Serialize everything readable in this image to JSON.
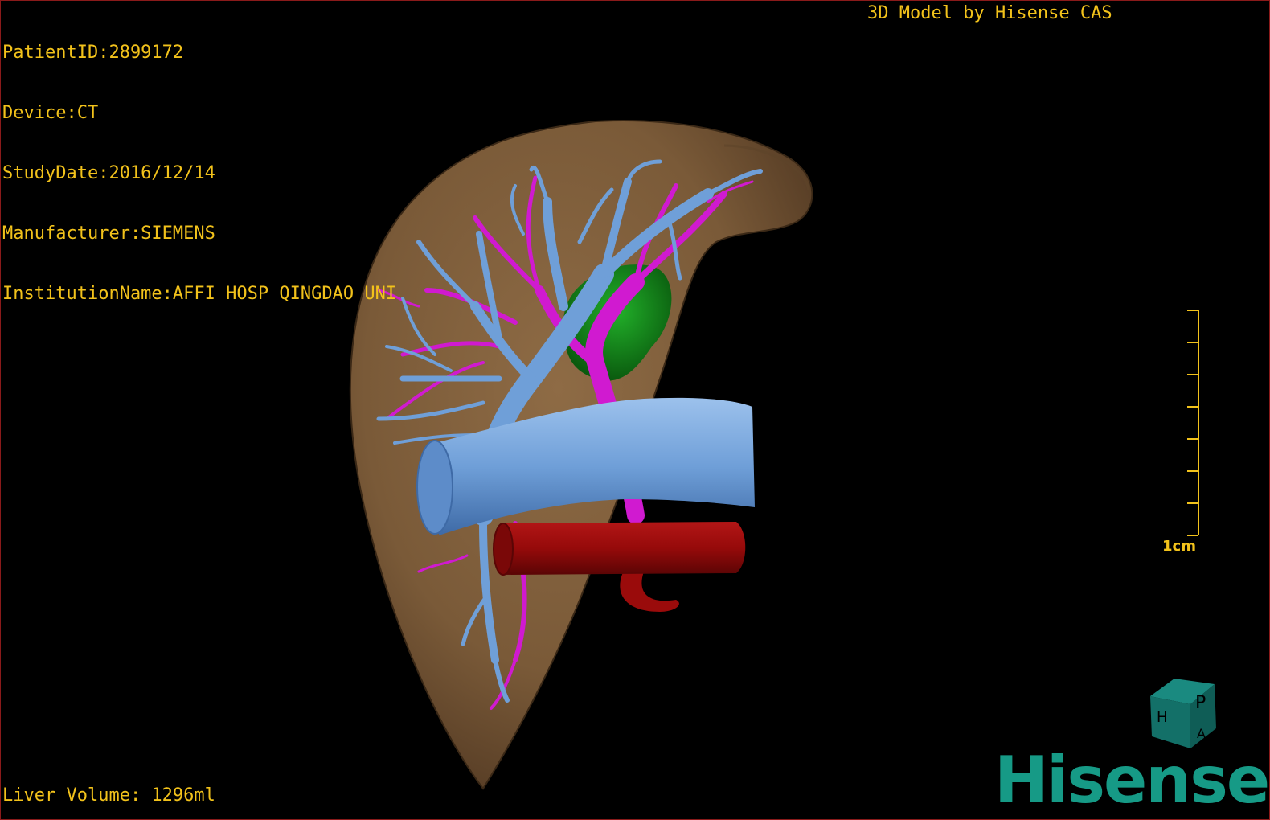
{
  "dicom_info": {
    "patient_id": "PatientID:2899172",
    "device": "Device:CT",
    "study_date": "StudyDate:2016/12/14",
    "manufacturer": "Manufacturer:SIEMENS",
    "institution": "InstitutionName:AFFI HOSP QINGDAO UNI"
  },
  "app_credit": "3D Model by Hisense CAS",
  "liver_volume": "Liver Volume: 1296ml",
  "scale_bar": {
    "label": "1cm"
  },
  "orientation_cube": {
    "labels": [
      "P",
      "H",
      "A"
    ],
    "icon": "orientation-cube-icon"
  },
  "brand": {
    "logo_text": "Hisense"
  },
  "colors": {
    "overlay_text": "#f2c21b",
    "liver": "#7b5a38",
    "portal_vein": "#6f9fd8",
    "hepatic_artery": "#d01ad0",
    "gallbladder": "#118a18",
    "inferior_vena_cava": "#9a0b0b",
    "brand": "#169a86",
    "background": "#000000"
  }
}
